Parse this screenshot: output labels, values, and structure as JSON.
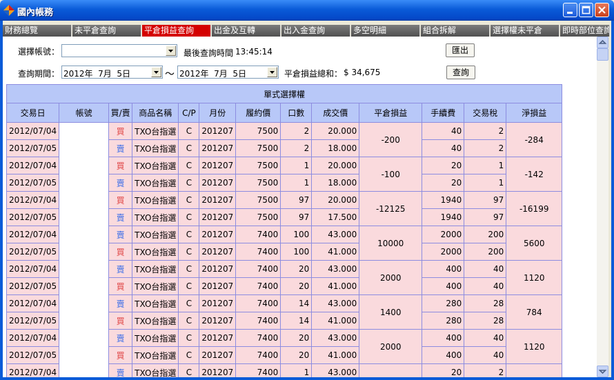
{
  "window": {
    "title": "國內帳務"
  },
  "tabs": [
    {
      "label": "財務總覽"
    },
    {
      "label": "未平倉查詢"
    },
    {
      "label": "平倉損益查詢"
    },
    {
      "label": "出金及互轉"
    },
    {
      "label": "出入金查詢"
    },
    {
      "label": "多空明細"
    },
    {
      "label": "組合拆解"
    },
    {
      "label": "選擇權未平倉"
    },
    {
      "label": "即時部位查詢"
    }
  ],
  "form": {
    "account_label": "選擇帳號：",
    "account_value": "",
    "last_query_label": "最後查詢時間",
    "last_query_time": "13:45:14",
    "export_button": "匯出",
    "period_label": "查詢期間：",
    "date_from": "2012年  7月  5日",
    "tilde": "～",
    "date_to": "2012年  7月  5日",
    "total_label": "平倉損益總和：",
    "total_value": "$ 34,675",
    "query_button": "查詢"
  },
  "table": {
    "group_title": "單式選擇權",
    "headers": [
      "交易日",
      "帳號",
      "買/賣",
      "商品名稱",
      "C/P",
      "月份",
      "履約價",
      "口數",
      "成交價",
      "平倉損益",
      "手續費",
      "交易稅",
      "淨損益"
    ],
    "pairs": [
      {
        "rows": [
          {
            "date": "2012/07/04",
            "side": "買",
            "product": "TXO台指選",
            "cp": "C",
            "month": "201207",
            "strike": "7500",
            "qty": "2",
            "price": "20.000",
            "fee": "40",
            "tax": "2"
          },
          {
            "date": "2012/07/05",
            "side": "賣",
            "product": "TXO台指選",
            "cp": "C",
            "month": "201207",
            "strike": "7500",
            "qty": "2",
            "price": "18.000",
            "fee": "40",
            "tax": "2"
          }
        ],
        "pnl": "-200",
        "net": "-284"
      },
      {
        "rows": [
          {
            "date": "2012/07/04",
            "side": "買",
            "product": "TXO台指選",
            "cp": "C",
            "month": "201207",
            "strike": "7500",
            "qty": "1",
            "price": "20.000",
            "fee": "20",
            "tax": "1"
          },
          {
            "date": "2012/07/05",
            "side": "賣",
            "product": "TXO台指選",
            "cp": "C",
            "month": "201207",
            "strike": "7500",
            "qty": "1",
            "price": "18.000",
            "fee": "20",
            "tax": "1"
          }
        ],
        "pnl": "-100",
        "net": "-142"
      },
      {
        "rows": [
          {
            "date": "2012/07/04",
            "side": "買",
            "product": "TXO台指選",
            "cp": "C",
            "month": "201207",
            "strike": "7500",
            "qty": "97",
            "price": "20.000",
            "fee": "1940",
            "tax": "97"
          },
          {
            "date": "2012/07/05",
            "side": "賣",
            "product": "TXO台指選",
            "cp": "C",
            "month": "201207",
            "strike": "7500",
            "qty": "97",
            "price": "17.500",
            "fee": "1940",
            "tax": "97"
          }
        ],
        "pnl": "-12125",
        "net": "-16199"
      },
      {
        "rows": [
          {
            "date": "2012/07/04",
            "side": "賣",
            "product": "TXO台指選",
            "cp": "C",
            "month": "201207",
            "strike": "7400",
            "qty": "100",
            "price": "43.000",
            "fee": "2000",
            "tax": "200"
          },
          {
            "date": "2012/07/05",
            "side": "買",
            "product": "TXO台指選",
            "cp": "C",
            "month": "201207",
            "strike": "7400",
            "qty": "100",
            "price": "41.000",
            "fee": "2000",
            "tax": "200"
          }
        ],
        "pnl": "10000",
        "net": "5600"
      },
      {
        "rows": [
          {
            "date": "2012/07/04",
            "side": "賣",
            "product": "TXO台指選",
            "cp": "C",
            "month": "201207",
            "strike": "7400",
            "qty": "20",
            "price": "43.000",
            "fee": "400",
            "tax": "40"
          },
          {
            "date": "2012/07/05",
            "side": "買",
            "product": "TXO台指選",
            "cp": "C",
            "month": "201207",
            "strike": "7400",
            "qty": "20",
            "price": "41.000",
            "fee": "400",
            "tax": "40"
          }
        ],
        "pnl": "2000",
        "net": "1120"
      },
      {
        "rows": [
          {
            "date": "2012/07/04",
            "side": "賣",
            "product": "TXO台指選",
            "cp": "C",
            "month": "201207",
            "strike": "7400",
            "qty": "14",
            "price": "43.000",
            "fee": "280",
            "tax": "28"
          },
          {
            "date": "2012/07/05",
            "side": "買",
            "product": "TXO台指選",
            "cp": "C",
            "month": "201207",
            "strike": "7400",
            "qty": "14",
            "price": "41.000",
            "fee": "280",
            "tax": "28"
          }
        ],
        "pnl": "1400",
        "net": "784"
      },
      {
        "rows": [
          {
            "date": "2012/07/04",
            "side": "賣",
            "product": "TXO台指選",
            "cp": "C",
            "month": "201207",
            "strike": "7400",
            "qty": "20",
            "price": "43.000",
            "fee": "400",
            "tax": "40"
          },
          {
            "date": "2012/07/05",
            "side": "買",
            "product": "TXO台指選",
            "cp": "C",
            "month": "201207",
            "strike": "7400",
            "qty": "20",
            "price": "41.000",
            "fee": "400",
            "tax": "40"
          }
        ],
        "pnl": "2000",
        "net": "1120"
      },
      {
        "rows": [
          {
            "date": "2012/07/04",
            "side": "賣",
            "product": "TXO台指選",
            "cp": "C",
            "month": "201207",
            "strike": "7400",
            "qty": "1",
            "price": "43.000",
            "fee": "20",
            "tax": "2"
          }
        ],
        "pnl": "",
        "net": ""
      }
    ]
  },
  "colors": {
    "buy": "#E04848",
    "sell": "#3C6EE8",
    "active_tab": "#D40000",
    "header_bg": "#B8C8F8",
    "row_bg": "#FADADD"
  }
}
